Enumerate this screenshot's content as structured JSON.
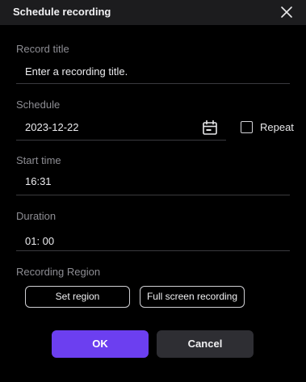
{
  "dialog": {
    "title": "Schedule recording",
    "close_icon": "close-icon"
  },
  "record_title": {
    "label": "Record title",
    "placeholder": "Enter a recording title."
  },
  "schedule": {
    "label": "Schedule",
    "date": "2023-12-22",
    "calendar_icon": "calendar-icon",
    "repeat_label": "Repeat",
    "repeat_checked": false
  },
  "start_time": {
    "label": "Start time",
    "value": "16:31"
  },
  "duration": {
    "label": "Duration",
    "value": "01: 00"
  },
  "recording_region": {
    "label": "Recording Region",
    "set_region_label": "Set region",
    "full_screen_label": "Full screen recording"
  },
  "actions": {
    "ok_label": "OK",
    "cancel_label": "Cancel"
  },
  "colors": {
    "accent": "#6c3ff0",
    "secondary_button": "#2e2e33",
    "background": "#000000",
    "titlebar": "#1c1c1e"
  }
}
